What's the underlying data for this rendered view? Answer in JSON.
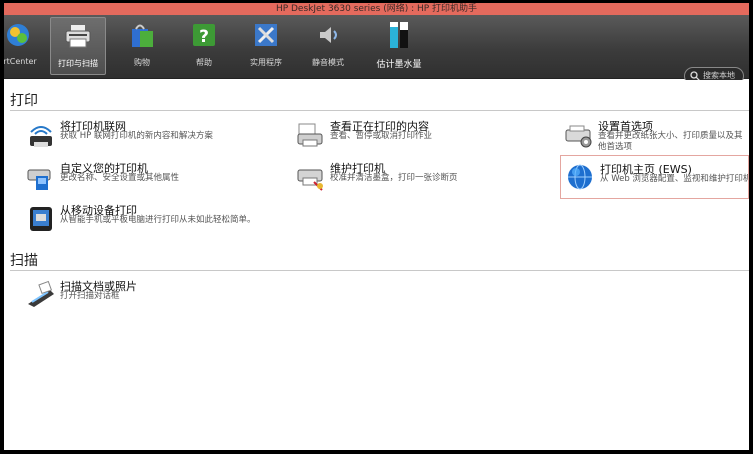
{
  "window": {
    "title": "HP DeskJet 3630 series (网络) : HP 打印机助手"
  },
  "ribbon": {
    "tabs": [
      {
        "label": "rtCenter"
      },
      {
        "label": "打印与扫描"
      },
      {
        "label": "购物"
      },
      {
        "label": "帮助"
      },
      {
        "label": "实用程序"
      },
      {
        "label": "静音模式"
      },
      {
        "label": "估计墨水量"
      }
    ],
    "search_label": "搜索本地"
  },
  "sections": {
    "print": {
      "title": "打印"
    },
    "scan": {
      "title": "扫描"
    }
  },
  "items": {
    "connect": {
      "title": "将打印机联网",
      "desc": "获取 HP 联网打印机的新内容和解决方案"
    },
    "view": {
      "title": "查看正在打印的内容",
      "desc": "查看、暂停或取消打印作业"
    },
    "prefs": {
      "title": "设置首选项",
      "desc": "查看并更改纸张大小、打印质量以及其他首选项"
    },
    "custom": {
      "title": "自定义您的打印机",
      "desc": "更改名称、安全设置或其他属性"
    },
    "maintain": {
      "title": "维护打印机",
      "desc": "校准并清洁墨盒，打印一张诊断页"
    },
    "ews": {
      "title": "打印机主页 (EWS)",
      "desc": "从 Web 浏览器配置、监视和维护打印机"
    },
    "mobile": {
      "title": "从移动设备打印",
      "desc": "从智能手机或平板电脑进行打印从未如此轻松简单。"
    },
    "scan": {
      "title": "扫描文档或照片",
      "desc": "打开扫描对话框"
    }
  },
  "colors": {
    "titlebar": "#e46a5d",
    "ribbon": "#3c3c3c",
    "accent": "#1a73c8"
  }
}
